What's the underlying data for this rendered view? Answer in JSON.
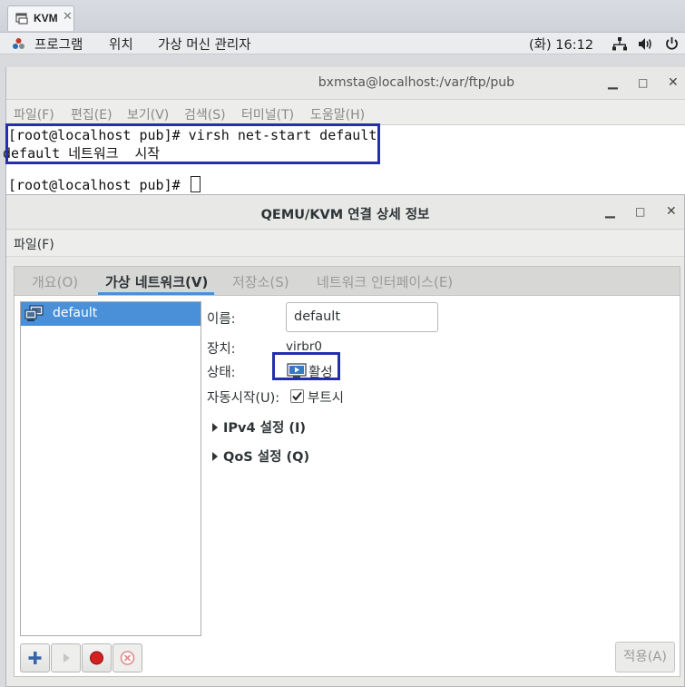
{
  "browser_tab": {
    "title": "KVM",
    "close": "✕"
  },
  "topbar": {
    "apps": "프로그램",
    "places": "위치",
    "app_name": "가상 머신 관리자",
    "clock": "(화) 16:12"
  },
  "terminal": {
    "title": "bxmsta@localhost:/var/ftp/pub",
    "menu": [
      "파일(F)",
      "편집(E)",
      "보기(V)",
      "검색(S)",
      "터미널(T)",
      "도움말(H)"
    ],
    "lines": [
      "[root@localhost pub]# virsh net-start default",
      "default 네트워크  시작",
      "",
      "[root@localhost pub]# "
    ]
  },
  "dialog": {
    "title": "QEMU/KVM 연결 상세 정보",
    "menu_file": "파일(F)",
    "tabs": [
      "개요(O)",
      "가상 네트워크(V)",
      "저장소(S)",
      "네트워크 인터페이스(E)"
    ],
    "active_tab": 1,
    "network_list": [
      {
        "name": "default"
      }
    ],
    "details": {
      "name_label": "이름:",
      "name_value": "default",
      "device_label": "장치:",
      "device_value": "virbr0",
      "state_label": "상태:",
      "state_value": "활성",
      "autostart_label": "자동시작(U):",
      "autostart_value": "부트시",
      "autostart_checked": true,
      "ipv4_label": "IPv4 설정 (I)",
      "qos_label": "QoS 설정 (Q)"
    },
    "buttons": {
      "add": "add-network",
      "start": "start-network",
      "stop": "stop-network",
      "delete": "delete-network",
      "apply": "적용(A)"
    }
  },
  "colors": {
    "selection": "#4a90d9",
    "highlight_box": "#2430a8",
    "stop_red": "#d42020"
  }
}
